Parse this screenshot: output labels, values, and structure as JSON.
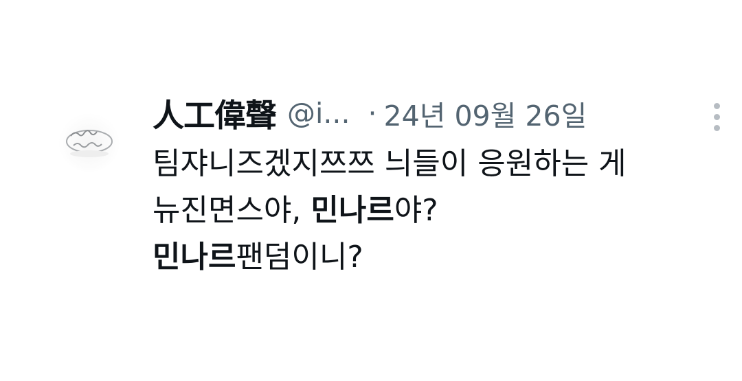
{
  "tweet": {
    "author_name": "人工偉聲",
    "author_handle": "@i...",
    "separator": "·",
    "date": "24년 09월 26일",
    "more_icon": "more-vertical-icon",
    "body_lines": [
      [
        {
          "text": "팀쟈니즈겠지쯔쯔 늬들이 응원하는 게",
          "bold": false
        }
      ],
      [
        {
          "text": "뉴진면스야, ",
          "bold": false
        },
        {
          "text": "민나르",
          "bold": true
        },
        {
          "text": "야?",
          "bold": false
        }
      ],
      [
        {
          "text": "민나르",
          "bold": true
        },
        {
          "text": "팬덤이니?",
          "bold": false
        }
      ]
    ]
  }
}
